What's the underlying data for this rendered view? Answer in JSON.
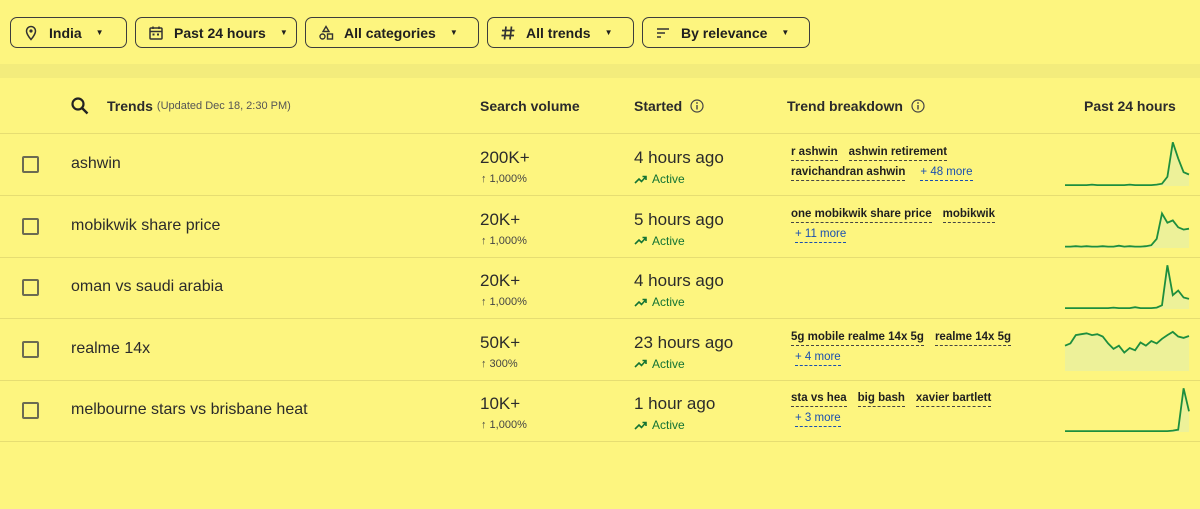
{
  "filters": {
    "location": "India",
    "time": "Past 24 hours",
    "category": "All categories",
    "trend_type": "All trends",
    "sort": "By relevance"
  },
  "header": {
    "trends": "Trends",
    "updated": "(Updated Dec 18, 2:30 PM)",
    "search_volume": "Search volume",
    "started": "Started",
    "breakdown": "Trend breakdown",
    "past": "Past 24 hours"
  },
  "rows": [
    {
      "name": "ashwin",
      "volume": "200K+",
      "change": "↑ 1,000%",
      "started": "4 hours ago",
      "status": "Active",
      "breakdown_line1": [
        "r ashwin",
        "ashwin retirement"
      ],
      "breakdown_line2": [
        "ravichandran ashwin"
      ],
      "more": "+ 48 more",
      "spark": [
        2,
        2,
        2,
        2,
        2,
        3,
        2,
        2,
        2,
        2,
        2,
        2,
        3,
        2,
        2,
        2,
        2,
        3,
        5,
        20,
        95,
        60,
        30,
        25
      ]
    },
    {
      "name": "mobikwik share price",
      "volume": "20K+",
      "change": "↑ 1,000%",
      "started": "5 hours ago",
      "status": "Active",
      "breakdown_line1": [
        "one mobikwik share price",
        "mobikwik"
      ],
      "breakdown_line2": [],
      "more": "+ 11 more",
      "spark": [
        3,
        3,
        4,
        3,
        4,
        3,
        3,
        4,
        3,
        3,
        5,
        3,
        4,
        3,
        3,
        4,
        6,
        20,
        75,
        55,
        60,
        45,
        40,
        42
      ]
    },
    {
      "name": "oman vs saudi arabia",
      "volume": "20K+",
      "change": "↑ 1,000%",
      "started": "4 hours ago",
      "status": "Active",
      "breakdown_line1": [],
      "breakdown_line2": [],
      "more": "",
      "spark": [
        2,
        2,
        2,
        2,
        2,
        2,
        2,
        2,
        2,
        3,
        2,
        2,
        2,
        4,
        2,
        2,
        2,
        3,
        8,
        95,
        30,
        40,
        25,
        22
      ]
    },
    {
      "name": "realme 14x",
      "volume": "50K+",
      "change": "↑ 300%",
      "started": "23 hours ago",
      "status": "Active",
      "breakdown_line1": [
        "5g mobile realme 14x 5g",
        "realme 14x 5g"
      ],
      "breakdown_line2": [],
      "more": "+ 4 more",
      "spark": [
        55,
        60,
        78,
        80,
        82,
        78,
        80,
        75,
        60,
        48,
        55,
        40,
        50,
        45,
        62,
        55,
        65,
        60,
        70,
        78,
        85,
        75,
        72,
        76
      ]
    },
    {
      "name": "melbourne stars vs brisbane heat",
      "volume": "10K+",
      "change": "↑ 1,000%",
      "started": "1 hour ago",
      "status": "Active",
      "breakdown_line1": [
        "sta vs hea",
        "big bash",
        "xavier bartlett"
      ],
      "breakdown_line2": [],
      "more": "+ 3 more",
      "spark": [
        2,
        2,
        2,
        2,
        2,
        2,
        2,
        2,
        2,
        2,
        2,
        2,
        2,
        2,
        2,
        2,
        2,
        2,
        2,
        2,
        3,
        5,
        95,
        45
      ]
    }
  ],
  "colors": {
    "spark": "#1e8e3e",
    "spark_fill": "#e6efa4",
    "active": "#137333"
  }
}
